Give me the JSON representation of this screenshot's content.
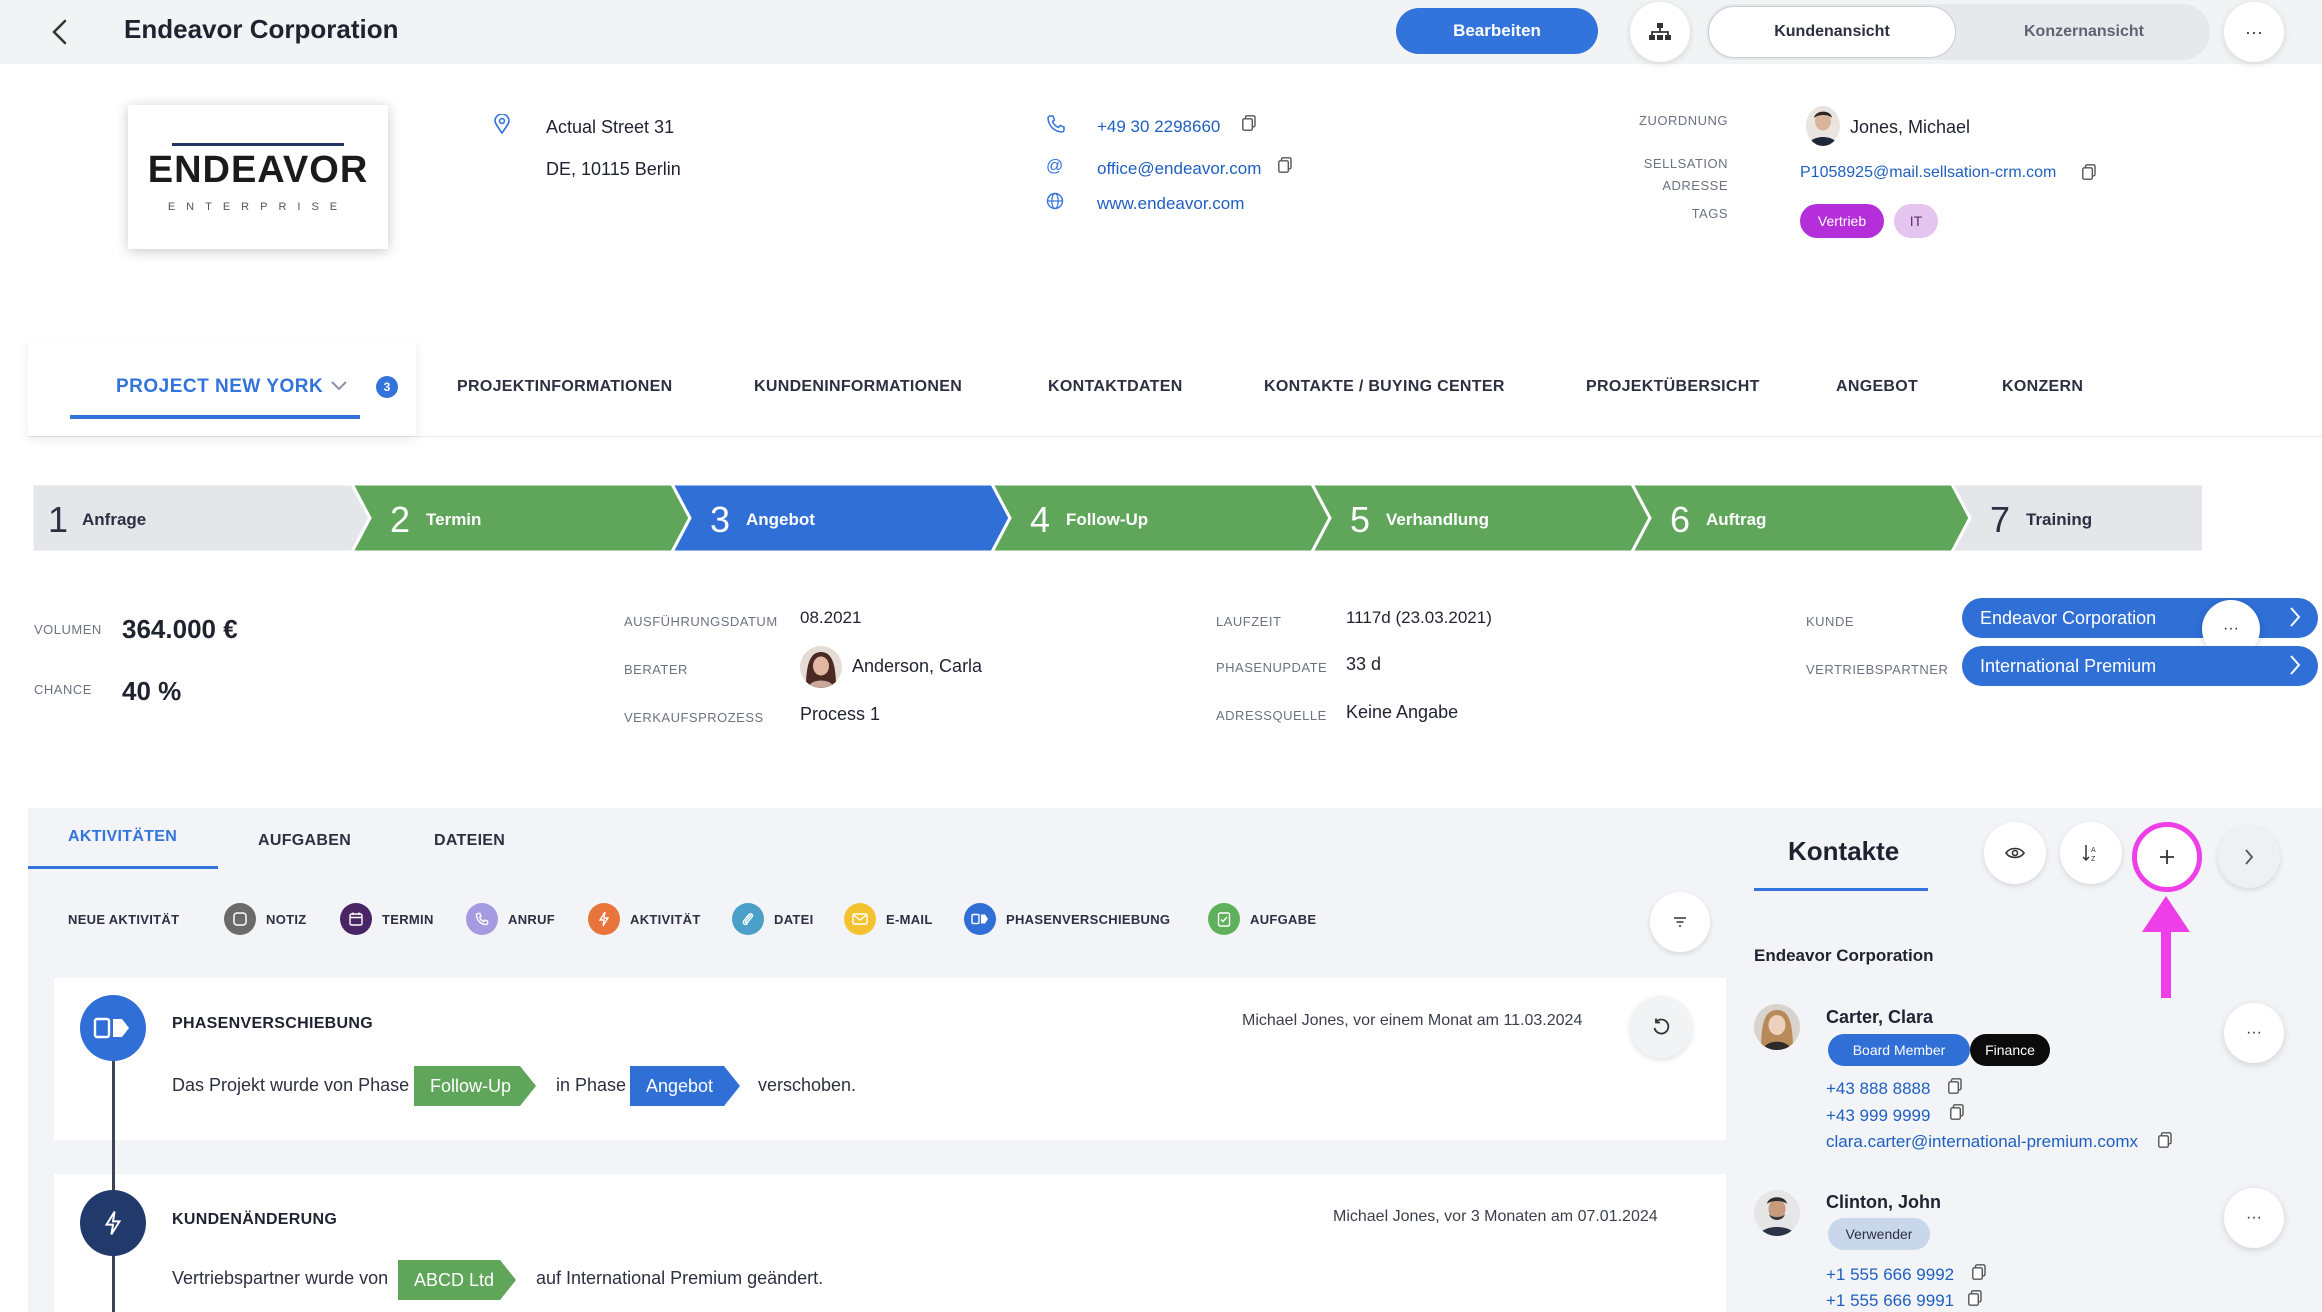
{
  "header": {
    "title": "Endeavor Corporation",
    "edit_label": "Bearbeiten",
    "view_customer": "Kundenansicht",
    "view_group": "Konzernansicht",
    "more": "···"
  },
  "company": {
    "logo_main": "ENDEAVOR",
    "logo_sub": "ENTERPRISE",
    "street": "Actual Street 31",
    "city": "DE, 10115 Berlin",
    "phone": "+49 30 2298660",
    "email": "office@endeavor.com",
    "website": "www.endeavor.com",
    "assignment_label": "ZUORDNUNG",
    "assignment_value": "Jones, Michael",
    "sellsation_label_1": "SELLSATION",
    "sellsation_label_2": "ADRESSE",
    "sellsation_value": "P1058925@mail.sellsation-crm.com",
    "tags_label": "TAGS",
    "tags": [
      "Vertrieb",
      "IT"
    ]
  },
  "project": {
    "name": "PROJECT NEW YORK",
    "badge": "3"
  },
  "nav_tabs": [
    "PROJEKTINFORMATIONEN",
    "KUNDENINFORMATIONEN",
    "KONTAKTDATEN",
    "KONTAKTE / BUYING CENTER",
    "PROJEKTÜBERSICHT",
    "ANGEBOT",
    "KONZERN"
  ],
  "phases": [
    {
      "num": "1",
      "label": "Anfrage",
      "state": "todo",
      "color": "#e4e6ea"
    },
    {
      "num": "2",
      "label": "Termin",
      "state": "done",
      "color": "#5fa55a"
    },
    {
      "num": "3",
      "label": "Angebot",
      "state": "current",
      "color": "#2f6fd6"
    },
    {
      "num": "4",
      "label": "Follow-Up",
      "state": "done",
      "color": "#5fa55a"
    },
    {
      "num": "5",
      "label": "Verhandlung",
      "state": "done",
      "color": "#5fa55a"
    },
    {
      "num": "6",
      "label": "Auftrag",
      "state": "done",
      "color": "#5fa55a"
    },
    {
      "num": "7",
      "label": "Training",
      "state": "todo",
      "color": "#e4e6ea"
    }
  ],
  "details": {
    "volume_label": "VOLUMEN",
    "volume": "364.000 €",
    "chance_label": "CHANCE",
    "chance": "40 %",
    "exec_label": "AUSFÜHRUNGSDATUM",
    "exec": "08.2021",
    "advisor_label": "BERATER",
    "advisor": "Anderson, Carla",
    "process_label": "VERKAUFSPROZESS",
    "process": "Process 1",
    "runtime_label": "LAUFZEIT",
    "runtime": "1117d (23.03.2021)",
    "phaseupdate_label": "PHASENUPDATE",
    "phaseupdate": "33 d",
    "source_label": "ADRESSQUELLE",
    "source": "Keine Angabe",
    "customer_label": "KUNDE",
    "customer": "Endeavor Corporation",
    "partner_label": "VERTRIEBSPARTNER",
    "partner": "International Premium",
    "dots": "···"
  },
  "activity_tabs": [
    "AKTIVITÄTEN",
    "AUFGABEN",
    "DATEIEN"
  ],
  "new_activity": {
    "label": "NEUE AKTIVITÄT",
    "items": [
      {
        "label": "NOTIZ",
        "icon": "note-icon",
        "color": "#6b6b6b"
      },
      {
        "label": "TERMIN",
        "icon": "calendar-icon",
        "color": "#4a2566"
      },
      {
        "label": "ANRUF",
        "icon": "phone-icon",
        "color": "#a59be0"
      },
      {
        "label": "AKTIVITÄT",
        "icon": "bolt-icon",
        "color": "#e8743b"
      },
      {
        "label": "DATEI",
        "icon": "paperclip-icon",
        "color": "#4aa0c9"
      },
      {
        "label": "E-MAIL",
        "icon": "mail-icon",
        "color": "#f2c230"
      },
      {
        "label": "PHASENVERSCHIEBUNG",
        "icon": "phase-shift-icon",
        "color": "#2f6fd6"
      },
      {
        "label": "AUFGABE",
        "icon": "task-icon",
        "color": "#5fb05a"
      }
    ]
  },
  "activities": [
    {
      "title": "PHASENVERSCHIEBUNG",
      "meta": "Michael Jones, vor einem Monat am 11.03.2024",
      "text_a": "Das Projekt wurde von Phase",
      "chip_a": "Follow-Up",
      "text_b": "in Phase",
      "chip_b": "Angebot",
      "text_c": "verschoben."
    },
    {
      "title": "KUNDENÄNDERUNG",
      "meta": "Michael Jones, vor 3 Monaten am 07.01.2024",
      "text_a": "Vertriebspartner wurde von",
      "chip_a": "ABCD Ltd",
      "text_b": "auf International Premium geändert."
    }
  ],
  "contacts": {
    "title": "Kontakte",
    "org": "Endeavor Corporation",
    "people": [
      {
        "name": "Carter, Clara",
        "roles": [
          "Board Member",
          "Finance"
        ],
        "phones": [
          "+43 888 8888",
          "+43 999 9999"
        ],
        "email": "clara.carter@international-premium.comx"
      },
      {
        "name": "Clinton, John",
        "roles": [
          "Verwender"
        ],
        "phones": [
          "+1 555 666 9992",
          "+1 555 666 9991"
        ]
      }
    ]
  },
  "colors": {
    "accent": "#3273dc",
    "green": "#5fa55a",
    "highlight": "#ee3ee8"
  }
}
